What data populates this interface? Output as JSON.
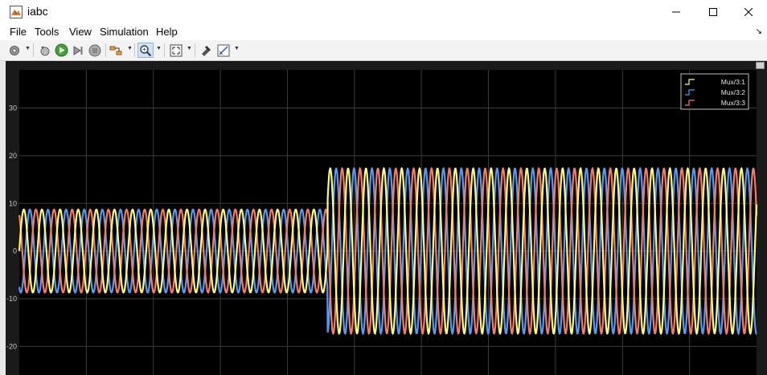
{
  "window": {
    "title": "iabc"
  },
  "menu": {
    "items": [
      "File",
      "Tools",
      "View",
      "Simulation",
      "Help"
    ]
  },
  "toolbar": {
    "buttons": [
      "configuration-properties",
      "step-back",
      "run",
      "step-forward",
      "stop",
      "signal-selector",
      "zoom-in",
      "autoscale",
      "highlight-simulink-block",
      "edit-cursors"
    ]
  },
  "colors": {
    "background": "#000000",
    "grid": "#3c3c3c",
    "axes_text": "#c8c8c8",
    "series_1": "#ffff6a",
    "series_2": "#4a9eff",
    "series_3": "#ff7a5a"
  },
  "chart_data": {
    "type": "line",
    "title": "",
    "xlabel": "",
    "ylabel": "",
    "ylim": [
      -26,
      38
    ],
    "yticks": [
      30,
      20,
      10,
      0,
      -10,
      -20
    ],
    "ytick_labels": [
      "30",
      "20",
      "10",
      "0",
      "-10",
      "-20"
    ],
    "grid": true,
    "legend_position": "top-right",
    "series": [
      {
        "name": "Mux/3:1",
        "color": "#ffff6a",
        "phase_deg": 0
      },
      {
        "name": "Mux/3:2",
        "color": "#4a9eff",
        "phase_deg": -120
      },
      {
        "name": "Mux/3:3",
        "color": "#ff7a5a",
        "phase_deg": 120
      }
    ],
    "segments": [
      {
        "cycles": 17,
        "amplitude": 8.7
      },
      {
        "cycles": 24,
        "amplitude": 17.3
      }
    ],
    "step_fraction": 0.418
  }
}
